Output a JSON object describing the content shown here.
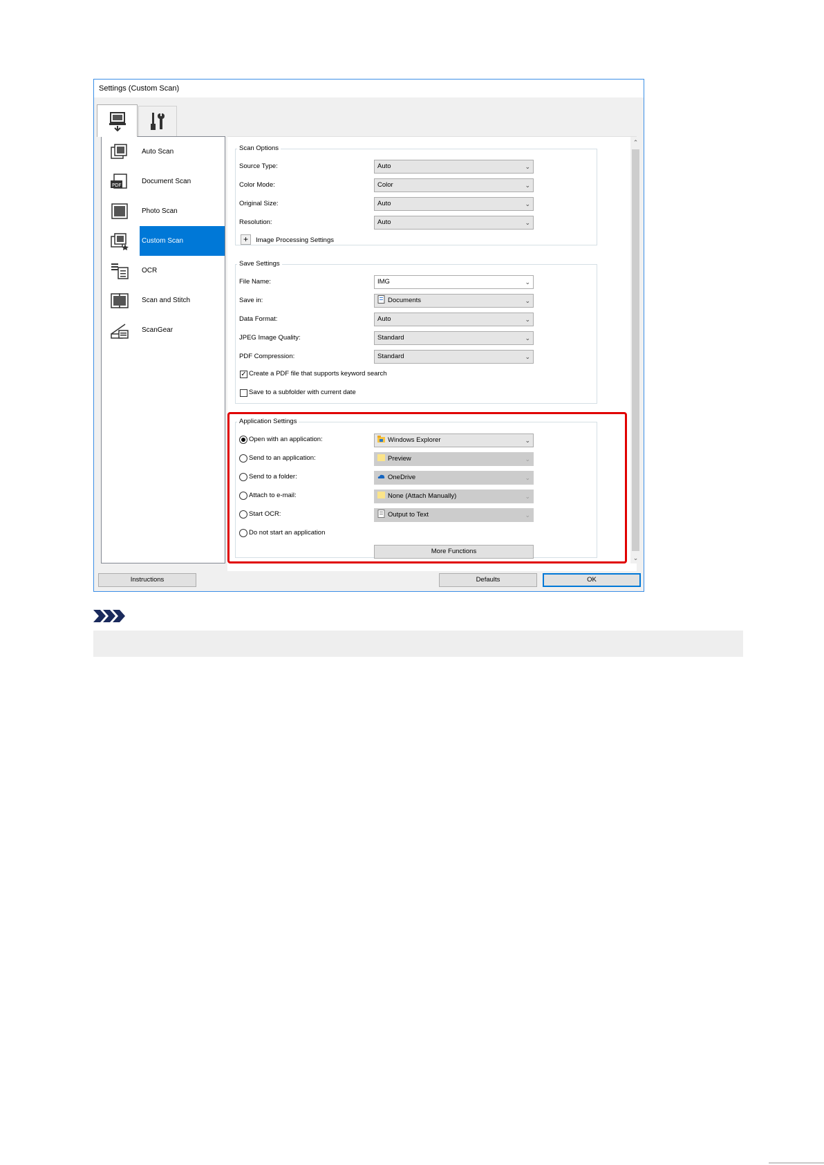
{
  "window": {
    "title": "Settings (Custom Scan)"
  },
  "tabs": [
    {
      "name": "scan-from-computer-tab",
      "icon": "computer-scan-icon"
    },
    {
      "name": "general-settings-tab",
      "icon": "tools-icon"
    }
  ],
  "scan_modes": [
    {
      "label": "Auto Scan",
      "icon": "auto-scan-icon",
      "selected": false
    },
    {
      "label": "Document Scan",
      "icon": "document-scan-icon",
      "selected": false
    },
    {
      "label": "Photo Scan",
      "icon": "photo-scan-icon",
      "selected": false
    },
    {
      "label": "Custom Scan",
      "icon": "custom-scan-icon",
      "selected": true
    },
    {
      "label": "OCR",
      "icon": "ocr-icon",
      "selected": false
    },
    {
      "label": "Scan and Stitch",
      "icon": "scan-and-stitch-icon",
      "selected": false
    },
    {
      "label": "ScanGear",
      "icon": "scangear-icon",
      "selected": false
    }
  ],
  "scan_options": {
    "title": "Scan Options",
    "source_type": {
      "label": "Source Type:",
      "value": "Auto"
    },
    "color_mode": {
      "label": "Color Mode:",
      "value": "Color"
    },
    "original_size": {
      "label": "Original Size:",
      "value": "Auto"
    },
    "resolution": {
      "label": "Resolution:",
      "value": "Auto"
    },
    "image_processing": {
      "label": "Image Processing Settings",
      "expand_glyph": "+"
    }
  },
  "save_settings": {
    "title": "Save Settings",
    "file_name": {
      "label": "File Name:",
      "value": "IMG"
    },
    "save_in": {
      "label": "Save in:",
      "value": "Documents",
      "icon": "documents-folder-icon"
    },
    "data_format": {
      "label": "Data Format:",
      "value": "Auto"
    },
    "jpeg_quality": {
      "label": "JPEG Image Quality:",
      "value": "Standard"
    },
    "pdf_compression": {
      "label": "PDF Compression:",
      "value": "Standard"
    },
    "keyword_search": {
      "label": "Create a PDF file that supports keyword search",
      "checked": true,
      "mark": "✓"
    },
    "subfolder_date": {
      "label": "Save to a subfolder with current date",
      "checked": false
    }
  },
  "application_settings": {
    "title": "Application Settings",
    "open_with_app": {
      "label": "Open with an application:",
      "value": "Windows Explorer",
      "selected": true,
      "icon": "windows-explorer-icon"
    },
    "send_to_app": {
      "label": "Send to an application:",
      "value": "Preview",
      "selected": false,
      "icon": "folder-icon"
    },
    "send_to_folder": {
      "label": "Send to a folder:",
      "value": "OneDrive",
      "selected": false,
      "icon": "onedrive-icon"
    },
    "attach_email": {
      "label": "Attach to e-mail:",
      "value": "None (Attach Manually)",
      "selected": false,
      "icon": "folder-icon"
    },
    "start_ocr": {
      "label": "Start OCR:",
      "value": "Output to Text",
      "selected": false,
      "icon": "text-output-icon"
    },
    "no_app": {
      "label": "Do not start an application",
      "selected": false
    },
    "more_functions": "More Functions"
  },
  "footer": {
    "instructions": "Instructions",
    "defaults": "Defaults",
    "ok": "OK"
  },
  "colors": {
    "accent": "#0078d7",
    "highlight_border": "#e00000",
    "window_border": "#3a8ee6"
  },
  "note": {
    "icon": "note-chevrons-icon"
  }
}
